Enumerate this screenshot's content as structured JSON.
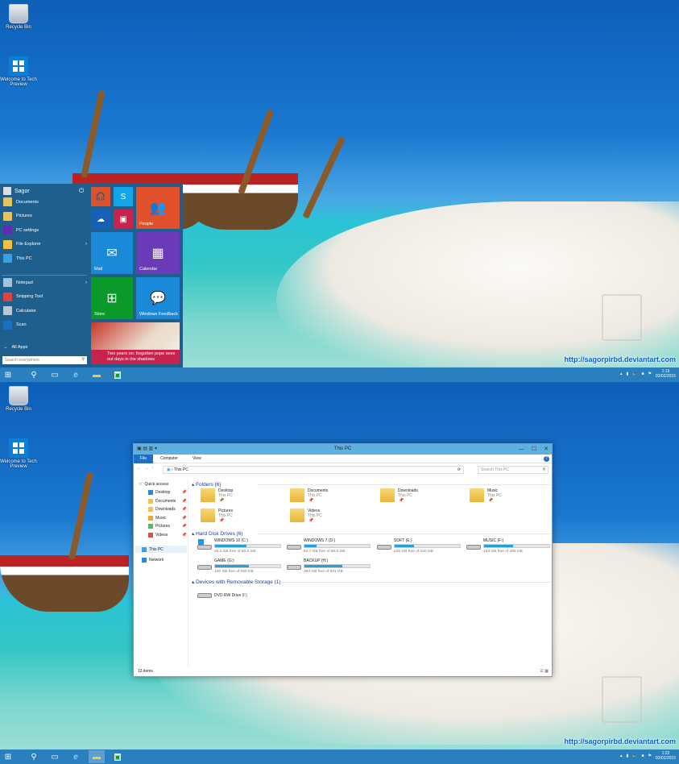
{
  "desktop_icons": [
    {
      "label": "Recycle Bin",
      "icon": "recycle-bin-icon"
    },
    {
      "label": "Welcome to Tech Preview",
      "icon": "windows-logo-icon"
    }
  ],
  "watermark_url": "http://sagorpirbd.deviantart.com",
  "colors": {
    "taskbar": "#2a7fbf",
    "start_bg": "#1f5f8e",
    "accent": "#1c6fc4",
    "drive_bar": "#26a0da"
  },
  "screens": [
    {
      "clock": {
        "time": "1:19",
        "date": "02/02/2015"
      }
    },
    {
      "clock": {
        "time": "1:22",
        "date": "02/02/2015"
      }
    }
  ],
  "taskbar": {
    "items": [
      {
        "name": "start-button",
        "icon": "windows-logo-icon"
      },
      {
        "name": "search-button",
        "icon": "search-icon"
      },
      {
        "name": "task-view-button",
        "icon": "task-view-icon"
      },
      {
        "name": "internet-explorer-button",
        "icon": "ie-icon"
      },
      {
        "name": "file-explorer-button",
        "icon": "folder-icon"
      },
      {
        "name": "store-button",
        "icon": "store-icon"
      }
    ]
  },
  "start_menu": {
    "user": "Sagor",
    "places": [
      {
        "label": "Documents",
        "icon": "documents-icon",
        "color": "#e7c25a"
      },
      {
        "label": "Pictures",
        "icon": "pictures-icon",
        "color": "#e7c25a"
      },
      {
        "label": "PC settings",
        "icon": "gear-icon",
        "color": "#5b2fb2"
      },
      {
        "label": "File Explorer",
        "icon": "folder-icon",
        "color": "#f0c040",
        "chevron": true
      },
      {
        "label": "This PC",
        "icon": "computer-icon",
        "color": "#3aa0e0"
      }
    ],
    "apps": [
      {
        "label": "Notepad",
        "icon": "notepad-icon",
        "color": "#9fc4dd",
        "chevron": true
      },
      {
        "label": "Snipping Tool",
        "icon": "scissors-icon",
        "color": "#d44"
      },
      {
        "label": "Calculator",
        "icon": "calculator-icon",
        "color": "#b8c8d6"
      },
      {
        "label": "Scan",
        "icon": "scan-icon",
        "color": "#1c6fc4"
      }
    ],
    "all_apps": "All Apps",
    "search_placeholder": "Search everywhere",
    "tiles": [
      {
        "label": "",
        "icon": "music-icon",
        "color": "#e0502a"
      },
      {
        "label": "",
        "icon": "skype-icon",
        "color": "#12a5e8"
      },
      {
        "label": "",
        "icon": "onedrive-icon",
        "color": "#1660b8"
      },
      {
        "label": "",
        "icon": "video-icon",
        "color": "#c8234c"
      },
      {
        "label": "People",
        "icon": "people-icon",
        "color": "#e0502a"
      },
      {
        "label": "Mail",
        "icon": "mail-icon",
        "color": "#1a8ad8"
      },
      {
        "label": "Calendar",
        "icon": "calendar-icon",
        "color": "#6a3ab8"
      },
      {
        "label": "Store",
        "icon": "store-icon",
        "color": "#0a9a2a"
      },
      {
        "label": "Windows Feedback",
        "icon": "feedback-icon",
        "color": "#1a8ad8"
      }
    ],
    "news": "Two years on: forgotten pope sees out days in the shadows"
  },
  "explorer": {
    "title": "This PC",
    "ribbon_tabs": [
      "File",
      "Computer",
      "View"
    ],
    "address": "This PC",
    "search_placeholder": "Search This PC",
    "nav": {
      "quick_access": "Quick access",
      "pinned": [
        "Desktop",
        "Documents",
        "Downloads",
        "Music",
        "Pictures",
        "Videos"
      ],
      "this_pc": "This PC",
      "network": "Network"
    },
    "folders_header": "Folders (6)",
    "folders": [
      {
        "name": "Desktop",
        "location": "This PC"
      },
      {
        "name": "Documents",
        "location": "This PC"
      },
      {
        "name": "Downloads",
        "location": "This PC"
      },
      {
        "name": "Music",
        "location": "This PC"
      },
      {
        "name": "Pictures",
        "location": "This PC"
      },
      {
        "name": "Videos",
        "location": "This PC"
      }
    ],
    "drives_header": "Hard Disk Drives (6)",
    "drives": [
      {
        "name": "WINDOWS 10 (C:)",
        "free": "26.2 GB free of 50.0 GB",
        "used_fraction": 0.48
      },
      {
        "name": "WINDOWS 7 (D:)",
        "free": "64.7 GB free of 80.0 GB",
        "used_fraction": 0.19
      },
      {
        "name": "SOFT (E:)",
        "free": "225 GB free of 320 GB",
        "used_fraction": 0.3
      },
      {
        "name": "MUSIC (F:)",
        "free": "153 GB free of 280 GB",
        "used_fraction": 0.45
      },
      {
        "name": "GAME (G:)",
        "free": "120 GB free of 250 GB",
        "used_fraction": 0.52
      },
      {
        "name": "BACKUP (H:)",
        "free": "394 GB free of 931 GB",
        "used_fraction": 0.58
      }
    ],
    "removable_header": "Devices with Removable Storage (1)",
    "removable": [
      {
        "name": "DVD RW Drive (I:)"
      }
    ],
    "status": "13 items"
  }
}
